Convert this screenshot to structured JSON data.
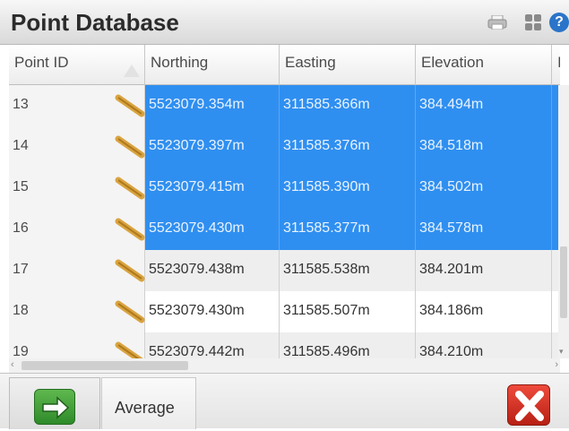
{
  "window": {
    "title": "Point Database"
  },
  "toolbar": {
    "icons": [
      "print-icon",
      "settings-icon",
      "help-icon"
    ],
    "help_glyph": "?"
  },
  "table": {
    "columns": [
      "Point ID",
      "Northing",
      "Easting",
      "Elevation",
      "I"
    ],
    "rows": [
      {
        "id": "13",
        "northing": "5523079.354m",
        "easting": "311585.366m",
        "elevation": "384.494m",
        "selected": true
      },
      {
        "id": "14",
        "northing": "5523079.397m",
        "easting": "311585.376m",
        "elevation": "384.518m",
        "selected": true
      },
      {
        "id": "15",
        "northing": "5523079.415m",
        "easting": "311585.390m",
        "elevation": "384.502m",
        "selected": true
      },
      {
        "id": "16",
        "northing": "5523079.430m",
        "easting": "311585.377m",
        "elevation": "384.578m",
        "selected": true
      },
      {
        "id": "17",
        "northing": "5523079.438m",
        "easting": "311585.538m",
        "elevation": "384.201m",
        "selected": false
      },
      {
        "id": "18",
        "northing": "5523079.430m",
        "easting": "311585.507m",
        "elevation": "384.186m",
        "selected": false
      },
      {
        "id": "19",
        "northing": "5523079.442m",
        "easting": "311585.496m",
        "elevation": "384.210m",
        "selected": false
      }
    ],
    "selection_color": "#2f8ff0"
  },
  "footer": {
    "ok_icon": "arrow-right-icon",
    "average_label": "Average",
    "cancel_icon": "close-icon"
  }
}
